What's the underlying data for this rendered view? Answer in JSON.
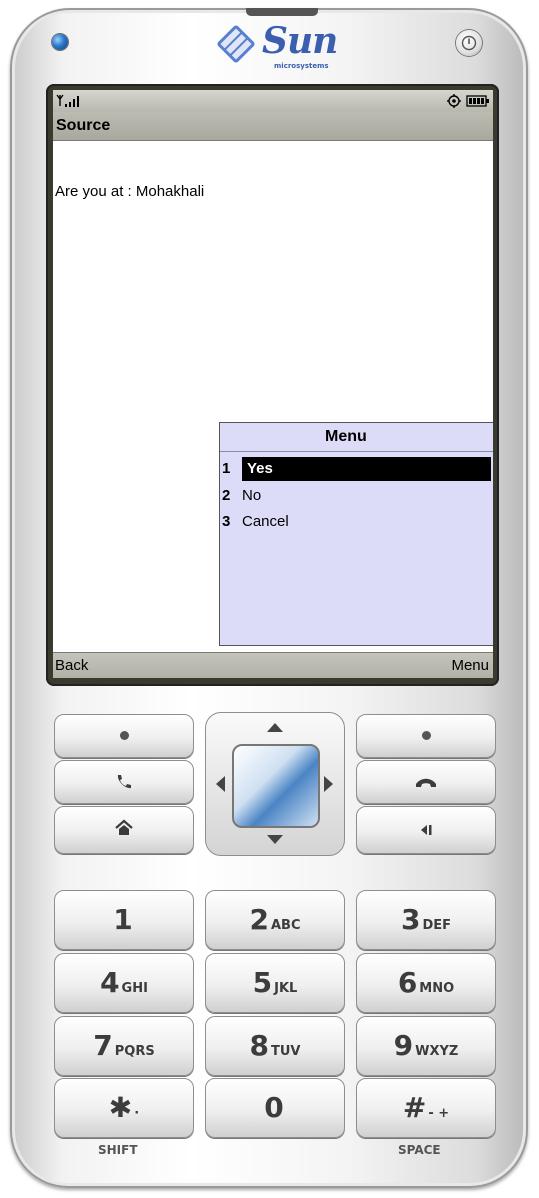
{
  "device": {
    "brand": "Sun",
    "brand_sub": "microsystems"
  },
  "screen": {
    "title": "Source",
    "message": "Are you at : Mohakhali",
    "softkeys": {
      "left": "Back",
      "right": "Menu"
    }
  },
  "menu": {
    "title": "Menu",
    "items": [
      {
        "num": "1",
        "label": "Yes",
        "selected": true
      },
      {
        "num": "2",
        "label": "No",
        "selected": false
      },
      {
        "num": "3",
        "label": "Cancel",
        "selected": false
      }
    ]
  },
  "keypad": {
    "keys": [
      {
        "digit": "1",
        "letters": ""
      },
      {
        "digit": "2",
        "letters": "ABC"
      },
      {
        "digit": "3",
        "letters": "DEF"
      },
      {
        "digit": "4",
        "letters": "GHI"
      },
      {
        "digit": "5",
        "letters": "JKL"
      },
      {
        "digit": "6",
        "letters": "MNO"
      },
      {
        "digit": "7",
        "letters": "PQRS"
      },
      {
        "digit": "8",
        "letters": "TUV"
      },
      {
        "digit": "9",
        "letters": "WXYZ"
      },
      {
        "digit": "✱",
        "letters": "·"
      },
      {
        "digit": "0",
        "letters": ""
      },
      {
        "digit": "#",
        "letters": "- +"
      }
    ],
    "shift_label": "SHIFT",
    "space_label": "SPACE"
  },
  "icons": {
    "left_soft_key": "dot-icon",
    "right_soft_key": "dot-icon",
    "call": "phone-call-icon",
    "end": "phone-end-icon",
    "home": "home-icon",
    "clear": "backspace-icon",
    "signal": "signal-icon",
    "battery": "battery-icon",
    "power": "power-icon",
    "led": "led-icon"
  },
  "colors": {
    "menu_bg": "#dcdcf8",
    "title_bar": "#b4b4aa",
    "selection": "#000000",
    "brand": "#3b5fae"
  }
}
